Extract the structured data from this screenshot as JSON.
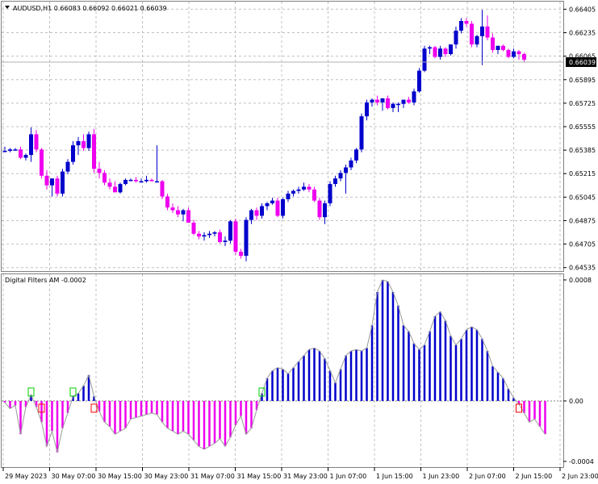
{
  "price_window": {
    "symbol_line": "AUDUSD,H1  0.66083 0.66092 0.66021 0.66039",
    "current_price": "0.66039",
    "y_ticks": [
      "0.66405",
      "0.66235",
      "0.66065",
      "0.65895",
      "0.65725",
      "0.65555",
      "0.65385",
      "0.65215",
      "0.65045",
      "0.64875",
      "0.64705",
      "0.64535"
    ]
  },
  "indicator_window": {
    "title": "Digital Filters AM -0.0002",
    "y_ticks": [
      "0.0008",
      "0.00",
      "-0.0004"
    ]
  },
  "time_axis": {
    "labels": [
      "29 May 2023",
      "30 May 07:00",
      "30 May 15:00",
      "30 May 23:00",
      "31 May 07:00",
      "31 May 15:00",
      "31 May 23:00",
      "1 Jun 07:00",
      "1 Jun 15:00",
      "1 Jun 23:00",
      "2 Jun 07:00",
      "2 Jun 15:00",
      "2 Jun 23:00"
    ]
  },
  "colors": {
    "bull": "#0000cc",
    "bear": "#ee00ee",
    "grid": "#c0c0c0",
    "signal_buy": "#00cc00",
    "signal_sell": "#ff0000",
    "filter_line": "#999999"
  },
  "chart_data": [
    {
      "type": "candlestick",
      "title": "AUDUSD,H1",
      "ylim": [
        0.6451,
        0.6646
      ],
      "candles": [
        [
          0.6538,
          0.6541,
          0.6537,
          0.6538
        ],
        [
          0.6538,
          0.654,
          0.6537,
          0.6539
        ],
        [
          0.6539,
          0.654,
          0.6538,
          0.6539
        ],
        [
          0.6539,
          0.6541,
          0.6532,
          0.6533
        ],
        [
          0.6533,
          0.6536,
          0.6531,
          0.6535
        ],
        [
          0.6535,
          0.6555,
          0.653,
          0.655
        ],
        [
          0.655,
          0.6553,
          0.6537,
          0.6539
        ],
        [
          0.6539,
          0.654,
          0.6518,
          0.652
        ],
        [
          0.652,
          0.6524,
          0.651,
          0.6513
        ],
        [
          0.6513,
          0.6518,
          0.6505,
          0.6518
        ],
        [
          0.6518,
          0.652,
          0.6505,
          0.6507
        ],
        [
          0.6507,
          0.6525,
          0.6505,
          0.6523
        ],
        [
          0.6523,
          0.6532,
          0.6521,
          0.653
        ],
        [
          0.653,
          0.6545,
          0.6528,
          0.6542
        ],
        [
          0.6542,
          0.6548,
          0.6535,
          0.6545
        ],
        [
          0.6545,
          0.655,
          0.6538,
          0.654
        ],
        [
          0.654,
          0.6552,
          0.6538,
          0.655
        ],
        [
          0.655,
          0.6554,
          0.6522,
          0.6525
        ],
        [
          0.6525,
          0.653,
          0.6518,
          0.6522
        ],
        [
          0.6522,
          0.6524,
          0.6513,
          0.6515
        ],
        [
          0.6515,
          0.6518,
          0.651,
          0.6512
        ],
        [
          0.6512,
          0.6516,
          0.6508,
          0.6508
        ],
        [
          0.6508,
          0.6515,
          0.6507,
          0.6514
        ],
        [
          0.6514,
          0.6518,
          0.6513,
          0.6517
        ],
        [
          0.6517,
          0.6518,
          0.6516,
          0.6517
        ],
        [
          0.6517,
          0.6519,
          0.6515,
          0.6516
        ],
        [
          0.6516,
          0.6518,
          0.6515,
          0.6516
        ],
        [
          0.6516,
          0.652,
          0.6515,
          0.6517
        ],
        [
          0.6517,
          0.6518,
          0.6516,
          0.6516
        ],
        [
          0.6516,
          0.6542,
          0.6515,
          0.6516
        ],
        [
          0.6516,
          0.6517,
          0.6503,
          0.6505
        ],
        [
          0.6505,
          0.6507,
          0.6495,
          0.6497
        ],
        [
          0.6497,
          0.65,
          0.6493,
          0.6495
        ],
        [
          0.6495,
          0.6498,
          0.649,
          0.6492
        ],
        [
          0.6492,
          0.6496,
          0.6487,
          0.6495
        ],
        [
          0.6495,
          0.6497,
          0.6486,
          0.6486
        ],
        [
          0.6486,
          0.6488,
          0.6477,
          0.6478
        ],
        [
          0.6478,
          0.648,
          0.6474,
          0.6476
        ],
        [
          0.6476,
          0.6479,
          0.6473,
          0.6477
        ],
        [
          0.6477,
          0.648,
          0.6475,
          0.6478
        ],
        [
          0.6478,
          0.648,
          0.6476,
          0.6479
        ],
        [
          0.6479,
          0.6481,
          0.6471,
          0.6472
        ],
        [
          0.6472,
          0.6476,
          0.6469,
          0.6473
        ],
        [
          0.6473,
          0.6488,
          0.6471,
          0.6487
        ],
        [
          0.6487,
          0.6489,
          0.6463,
          0.6465
        ],
        [
          0.6465,
          0.6467,
          0.646,
          0.6462
        ],
        [
          0.6462,
          0.649,
          0.6458,
          0.6488
        ],
        [
          0.6488,
          0.6496,
          0.6485,
          0.6495
        ],
        [
          0.6495,
          0.6497,
          0.6488,
          0.6491
        ],
        [
          0.6491,
          0.65,
          0.6489,
          0.6498
        ],
        [
          0.6498,
          0.6501,
          0.6495,
          0.65
        ],
        [
          0.65,
          0.6504,
          0.6499,
          0.6502
        ],
        [
          0.6502,
          0.6504,
          0.649,
          0.6491
        ],
        [
          0.6491,
          0.6504,
          0.6489,
          0.6503
        ],
        [
          0.6503,
          0.6509,
          0.6501,
          0.6507
        ],
        [
          0.6507,
          0.651,
          0.6505,
          0.6509
        ],
        [
          0.6509,
          0.6512,
          0.6507,
          0.651
        ],
        [
          0.651,
          0.6515,
          0.6509,
          0.6512
        ],
        [
          0.6512,
          0.6514,
          0.6508,
          0.651
        ],
        [
          0.651,
          0.6512,
          0.6501,
          0.6502
        ],
        [
          0.6502,
          0.6504,
          0.6488,
          0.649
        ],
        [
          0.649,
          0.6502,
          0.6485,
          0.65
        ],
        [
          0.65,
          0.6516,
          0.6498,
          0.6514
        ],
        [
          0.6514,
          0.652,
          0.6512,
          0.6518
        ],
        [
          0.6518,
          0.6524,
          0.6516,
          0.6522
        ],
        [
          0.6522,
          0.6528,
          0.6507,
          0.6526
        ],
        [
          0.6526,
          0.6533,
          0.6524,
          0.6531
        ],
        [
          0.6531,
          0.654,
          0.6529,
          0.6539
        ],
        [
          0.6539,
          0.6565,
          0.6537,
          0.6563
        ],
        [
          0.6563,
          0.6575,
          0.656,
          0.6573
        ],
        [
          0.6573,
          0.6576,
          0.657,
          0.6575
        ],
        [
          0.6575,
          0.6578,
          0.6571,
          0.6573
        ],
        [
          0.6573,
          0.6576,
          0.6567,
          0.6576
        ],
        [
          0.6576,
          0.6578,
          0.6568,
          0.6569
        ],
        [
          0.6569,
          0.6573,
          0.6566,
          0.6572
        ],
        [
          0.6572,
          0.6573,
          0.6566,
          0.6572
        ],
        [
          0.6572,
          0.6575,
          0.6569,
          0.6575
        ],
        [
          0.6575,
          0.6577,
          0.6572,
          0.6573
        ],
        [
          0.6573,
          0.6583,
          0.6571,
          0.6581
        ],
        [
          0.6581,
          0.6598,
          0.658,
          0.6596
        ],
        [
          0.6596,
          0.6614,
          0.6595,
          0.6612
        ],
        [
          0.6612,
          0.6614,
          0.6608,
          0.6613
        ],
        [
          0.6613,
          0.6614,
          0.6605,
          0.6606
        ],
        [
          0.6606,
          0.6614,
          0.6604,
          0.6612
        ],
        [
          0.6612,
          0.6613,
          0.6606,
          0.6608
        ],
        [
          0.6608,
          0.6615,
          0.6607,
          0.6615
        ],
        [
          0.6615,
          0.6628,
          0.6612,
          0.6625
        ],
        [
          0.6625,
          0.6634,
          0.6623,
          0.6632
        ],
        [
          0.6632,
          0.6634,
          0.6628,
          0.663
        ],
        [
          0.663,
          0.6632,
          0.6613,
          0.6615
        ],
        [
          0.6615,
          0.6622,
          0.6613,
          0.6621
        ],
        [
          0.6621,
          0.664,
          0.66,
          0.6628
        ],
        [
          0.6628,
          0.6636,
          0.6618,
          0.662
        ],
        [
          0.662,
          0.6623,
          0.6609,
          0.6611
        ],
        [
          0.6611,
          0.6614,
          0.6608,
          0.6614
        ],
        [
          0.6614,
          0.6615,
          0.661,
          0.6611
        ],
        [
          0.6611,
          0.6612,
          0.6605,
          0.6606
        ],
        [
          0.6606,
          0.6612,
          0.6605,
          0.661
        ],
        [
          0.661,
          0.6611,
          0.6604,
          0.6608
        ],
        [
          0.6608,
          0.6609,
          0.6602,
          0.6604
        ]
      ]
    },
    {
      "type": "bar",
      "title": "Digital Filters AM -0.0002",
      "ylim": [
        -0.0004,
        0.0008
      ],
      "values": [
        -1e-05,
        -5e-05,
        -3e-05,
        -0.00022,
        -4e-05,
        4e-05,
        -4e-05,
        -0.00014,
        -0.0003,
        -0.0002,
        -0.00034,
        -0.00018,
        -8e-05,
        3e-05,
        5e-05,
        0.0001,
        0.00017,
        3e-05,
        -7e-05,
        -0.00014,
        -0.00017,
        -0.00022,
        -0.0002,
        -0.00018,
        -0.00012,
        -0.00011,
        -0.0001,
        -9e-05,
        -8e-05,
        -9e-05,
        -0.00014,
        -0.00018,
        -0.0002,
        -0.00022,
        -0.0002,
        -0.00022,
        -0.00026,
        -0.0003,
        -0.00032,
        -0.0003,
        -0.00028,
        -0.00025,
        -0.0003,
        -0.00024,
        -0.00016,
        -0.0001,
        -0.00022,
        -0.00018,
        -6e-05,
        5e-05,
        0.00015,
        0.0002,
        0.00022,
        0.00021,
        0.00018,
        0.00022,
        0.00026,
        0.0003,
        0.00034,
        0.00035,
        0.00033,
        0.00028,
        0.0002,
        0.00012,
        0.00021,
        0.0003,
        0.00033,
        0.00034,
        0.00033,
        0.00035,
        0.0005,
        0.00072,
        0.0008,
        0.00079,
        0.00072,
        0.00063,
        0.0005,
        0.00046,
        0.00038,
        0.00034,
        0.00037,
        0.00046,
        0.00056,
        0.00059,
        0.00053,
        0.00043,
        0.00037,
        0.00041,
        0.00047,
        0.00049,
        0.00047,
        0.00041,
        0.00033,
        0.00023,
        0.00019,
        0.00015,
        8e-05,
        2e-05,
        -2e-05,
        -8e-05,
        -0.00014,
        -0.00012,
        -0.00017,
        -0.00022
      ],
      "buy_signals": [
        5,
        13,
        49
      ],
      "sell_signals": [
        7,
        17,
        98
      ]
    }
  ]
}
